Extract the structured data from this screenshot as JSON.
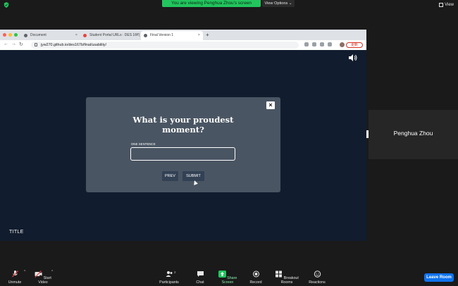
{
  "zoom": {
    "share_banner": "You are viewing Penghua Zhou's screen",
    "view_options": "View Options ⌄",
    "view_label": "View"
  },
  "browser": {
    "tabs": [
      {
        "label": "Document",
        "active": false
      },
      {
        "label": "Student Portal URLs : DES 167(",
        "active": false
      },
      {
        "label": "Final Version 1",
        "active": true
      }
    ],
    "url": "jyw270.github.io/des167b/final/usability/",
    "update_label": "更新"
  },
  "modal": {
    "question": "What is your proudest moment?",
    "field_label": "ONE SENTENCE",
    "answer_value": "",
    "prev_label": "PREV",
    "submit_label": "SUBMIT",
    "close_label": "×"
  },
  "page": {
    "title_label": "TITLE"
  },
  "participant": {
    "name": "Penghua Zhou"
  },
  "toolbar": {
    "unmute": "Unmute",
    "start_video": "Start Video",
    "participants": "Participants",
    "participants_count": "2",
    "chat": "Chat",
    "share_screen": "Share Screen",
    "record": "Record",
    "breakout_rooms": "Breakout Rooms",
    "reactions": "Reactions",
    "leave_room": "Leave Room"
  },
  "colors": {
    "accent_green": "#22c55e",
    "leave_blue": "#0e72ed",
    "page_bg": "#111c2e",
    "modal_bg": "#4a5563"
  }
}
